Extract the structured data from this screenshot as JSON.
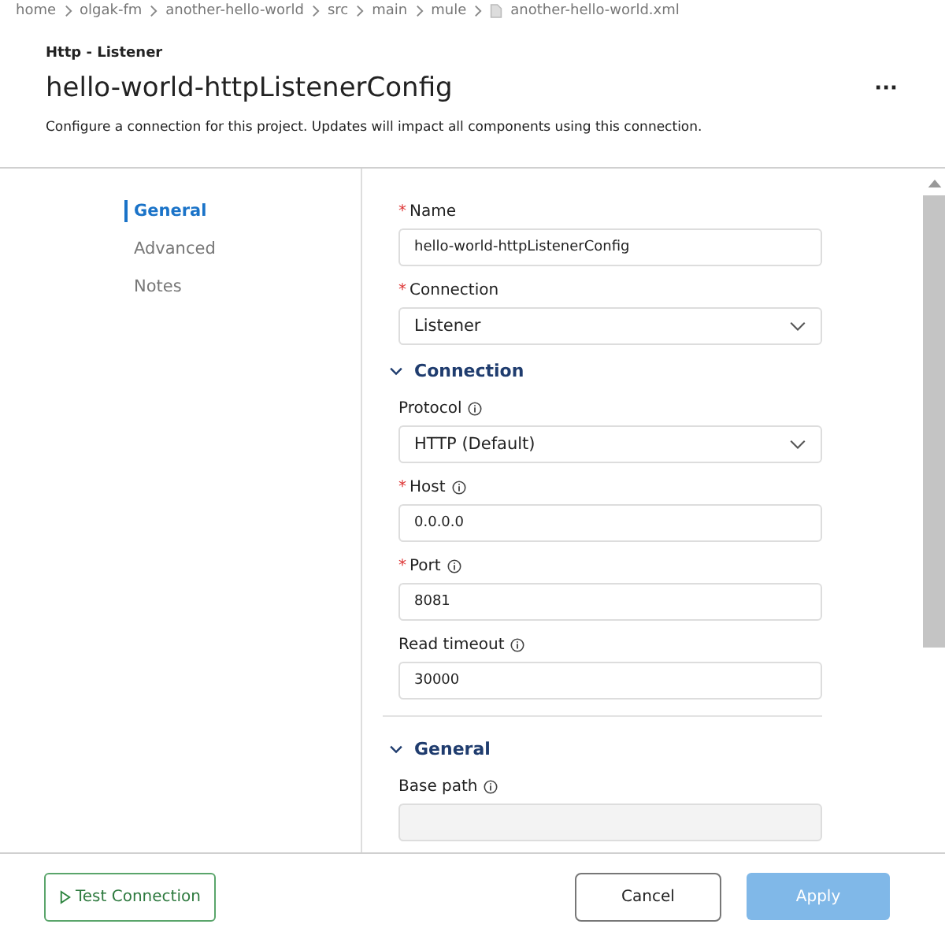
{
  "breadcrumb": {
    "items": [
      "home",
      "olgak-fm",
      "another-hello-world",
      "src",
      "main",
      "mule"
    ],
    "file": "another-hello-world.xml"
  },
  "header": {
    "subtitle": "Http - Listener",
    "title": "hello-world-httpListenerConfig",
    "more": "···",
    "description": "Configure a connection for this project. Updates will impact all components using this connection."
  },
  "nav": [
    {
      "label": "General",
      "selected": true
    },
    {
      "label": "Advanced",
      "selected": false
    },
    {
      "label": "Notes",
      "selected": false
    }
  ],
  "form": [
    {
      "kind": "input",
      "label": "Name",
      "required_mark": "*",
      "info": false,
      "value": "hello-world-httpListenerConfig"
    },
    {
      "kind": "select",
      "label": "Connection",
      "required_mark": "*",
      "info": false,
      "value": "Listener"
    },
    {
      "kind": "section",
      "label": "Connection",
      "expanded": true
    },
    {
      "kind": "select",
      "label": "Protocol",
      "info": true,
      "value": "HTTP (Default)"
    },
    {
      "kind": "input",
      "label": "Host",
      "required_mark": "*",
      "info": true,
      "value": "0.0.0.0"
    },
    {
      "kind": "input",
      "label": "Port",
      "required_mark": "*",
      "info": true,
      "value": "8081"
    },
    {
      "kind": "input",
      "label": "Read timeout",
      "info": true,
      "value": "30000"
    },
    {
      "kind": "divider"
    },
    {
      "kind": "section",
      "label": "General",
      "expanded": true
    },
    {
      "kind": "input",
      "label": "Base path",
      "info": true
    }
  ],
  "footer": {
    "test": "Test Connection",
    "cancel": "Cancel",
    "apply": {
      "label": "Apply",
      "disabled": true
    }
  }
}
